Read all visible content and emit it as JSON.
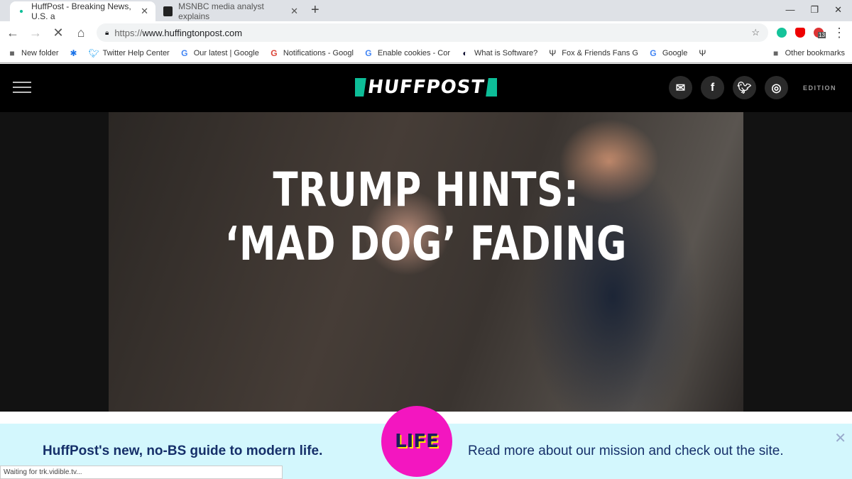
{
  "browser": {
    "tabs": [
      {
        "title": "HuffPost - Breaking News, U.S. a",
        "active": true
      },
      {
        "title": "MSNBC media analyst explains",
        "active": false
      }
    ],
    "new_tab": "+",
    "url_scheme": "https://",
    "url_host": "www.huffingtonpost.com",
    "extension_badge": "13",
    "bookmarks": [
      {
        "label": "New folder",
        "icon": "folder-icon"
      },
      {
        "label": "",
        "icon": "gear-icon"
      },
      {
        "label": "Twitter Help Center",
        "icon": "twitter-icon"
      },
      {
        "label": "Our latest | Google",
        "icon": "google-icon"
      },
      {
        "label": "Notifications - Googl",
        "icon": "google-plus-icon"
      },
      {
        "label": "Enable  cookies - Cor",
        "icon": "google-icon"
      },
      {
        "label": "What is Software?",
        "icon": "software-icon"
      },
      {
        "label": "Fox & Friends Fans G",
        "icon": "fox-fans-icon"
      },
      {
        "label": "Google",
        "icon": "google-icon"
      },
      {
        "label": "",
        "icon": "fox-fans-icon"
      }
    ],
    "other_bookmarks": "Other bookmarks",
    "status": "Waiting for trk.vidible.tv..."
  },
  "site": {
    "logo": "HUFFPOST",
    "edition": "EDITION",
    "brand_color": "#0dbe98",
    "headline_line1": "TRUMP HINTS:",
    "headline_line2": "‘MAD DOG’ FADING"
  },
  "banner": {
    "left_text": "HuffPost's new, no-BS guide to modern life.",
    "badge": "LIFE",
    "right_text": "Read more about our mission and check out the site.",
    "close": "✕"
  }
}
